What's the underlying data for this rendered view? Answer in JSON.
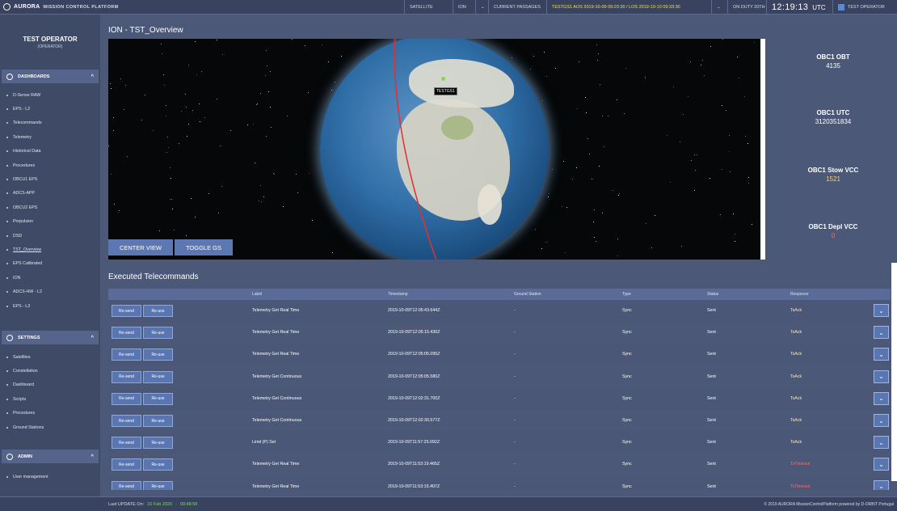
{
  "topbar": {
    "brand": "AURORA",
    "platform": "MISSION CONTROL PLATFORM",
    "satellite_label": "SATELLITE",
    "satellite_value": "ION",
    "passages_label": "CURRENT PASSAGES",
    "passage_text": "TESTGS1 AOS 2019-10-09 09:23:30 / LOS 2019-10-10 09:33:30",
    "on_duty": "ON DUTY 20TH",
    "clock": "12:19:13",
    "tz": "UTC",
    "operator": "TEST OPERATOR"
  },
  "operator": {
    "name": "TEST OPERATOR",
    "role": "(OPERATOR)"
  },
  "sidebar": {
    "dashboards_label": "DASHBOARDS",
    "dashboards": [
      "D-Sense RAW",
      "EPS - L2",
      "Telecommands",
      "Telemetry",
      "Historical Data",
      "Procedures",
      "OBCU1 EPS",
      "ADCS-APP",
      "OBCU2 EPS",
      "Propulsion",
      "DSD",
      "TST_Overview",
      "EPS Calibrated",
      "ION",
      "ADCS-HW - L2",
      "EPS - L3"
    ],
    "settings_label": "SETTINGS",
    "settings": [
      "Satellites",
      "Constellation",
      "Dashboard",
      "Scripts",
      "Procedures",
      "Ground Stations"
    ],
    "admin_label": "ADMIN",
    "admin": [
      "User management"
    ]
  },
  "view": {
    "title": "ION - TST_Overview",
    "center_view": "CENTER VIEW",
    "toggle_gs": "TOGGLE GS",
    "gs_label": "TESTGS1"
  },
  "telemetry": [
    {
      "name": "OBC1 OBT",
      "value": "4135",
      "color": "#ffffff"
    },
    {
      "name": "OBC1 UTC",
      "value": "3120351834",
      "color": "#ffffff"
    },
    {
      "name": "OBC1 Stow VCC",
      "value": "1521",
      "color": "#ffcc66"
    },
    {
      "name": "OBC1 Depl VCC",
      "value": "0",
      "color": "#ff6b6b"
    }
  ],
  "table": {
    "title": "Executed Telecommands",
    "headers": [
      "Label",
      "Timestamp",
      "Ground Station",
      "Type",
      "Status",
      "Response"
    ],
    "resend": "Re-send",
    "reuse": "Re-use",
    "rows": [
      {
        "label": "Telemetry Get Real Time",
        "ts": "2019-10-09T12:05:43.644Z",
        "gs": "-",
        "type": "Sync",
        "status": "Sent",
        "resp": "TsAck"
      },
      {
        "label": "Telemetry Get Real Time",
        "ts": "2019-10-09T12:05:15.430Z",
        "gs": "-",
        "type": "Sync",
        "status": "Sent",
        "resp": "TsAck"
      },
      {
        "label": "Telemetry Get Real Time",
        "ts": "2019-10-09T12:05:05.095Z",
        "gs": "-",
        "type": "Sync",
        "status": "Sent",
        "resp": "TsAck"
      },
      {
        "label": "Telemetry Get Continuous",
        "ts": "2019-10-09T12:05:05.580Z",
        "gs": "-",
        "type": "Sync",
        "status": "Sent",
        "resp": "TsAck"
      },
      {
        "label": "Telemetry Get Continuous",
        "ts": "2019-10-09T12:02:31.700Z",
        "gs": "-",
        "type": "Sync",
        "status": "Sent",
        "resp": "TsAck"
      },
      {
        "label": "Telemetry Get Continuous",
        "ts": "2019-10-09T12:02:30.577Z",
        "gs": "-",
        "type": "Sync",
        "status": "Sent",
        "resp": "TsAck"
      },
      {
        "label": "Limit (P) Set",
        "ts": "2019-10-09T11:57:25.092Z",
        "gs": "-",
        "type": "Sync",
        "status": "Sent",
        "resp": "TsAck"
      },
      {
        "label": "Telemetry Get Real Time",
        "ts": "2019-10-09T11:53:19.465Z",
        "gs": "-",
        "type": "Sync",
        "status": "Sent",
        "resp": "TsTimeout"
      },
      {
        "label": "Telemetry Get Real Time",
        "ts": "2019-10-09T11:53:15.407Z",
        "gs": "-",
        "type": "Sync",
        "status": "Sent",
        "resp": "TsTimeout"
      }
    ]
  },
  "footer": {
    "last_update_label": "Last UPDATE On:",
    "last_update_date": "10 Feb 2020",
    "last_update_time": "09:48:58",
    "copyright": "© 2019 AURORA MissionControlPlatform powered by D-ORBIT Portugal"
  }
}
